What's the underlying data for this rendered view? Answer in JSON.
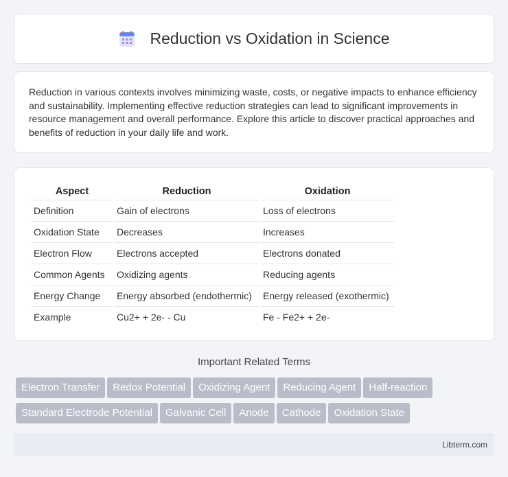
{
  "header": {
    "title": "Reduction vs Oxidation in Science",
    "icon": "calendar-icon"
  },
  "intro": {
    "text": "Reduction in various contexts involves minimizing waste, costs, or negative impacts to enhance efficiency and sustainability. Implementing effective reduction strategies can lead to significant improvements in resource management and overall performance. Explore this article to discover practical approaches and benefits of reduction in your daily life and work."
  },
  "table": {
    "headers": [
      "Aspect",
      "Reduction",
      "Oxidation"
    ],
    "rows": [
      [
        "Definition",
        "Gain of electrons",
        "Loss of electrons"
      ],
      [
        "Oxidation State",
        "Decreases",
        "Increases"
      ],
      [
        "Electron Flow",
        "Electrons accepted",
        "Electrons donated"
      ],
      [
        "Common Agents",
        "Oxidizing agents",
        "Reducing agents"
      ],
      [
        "Energy Change",
        "Energy absorbed (endothermic)",
        "Energy released (exothermic)"
      ],
      [
        "Example",
        "Cu2+ + 2e- - Cu",
        "Fe - Fe2+ + 2e-"
      ]
    ]
  },
  "related": {
    "title": "Important Related Terms",
    "tags": [
      "Electron Transfer",
      "Redox Potential",
      "Oxidizing Agent",
      "Reducing Agent",
      "Half-reaction",
      "Standard Electrode Potential",
      "Galvanic Cell",
      "Anode",
      "Cathode",
      "Oxidation State"
    ]
  },
  "footer": {
    "text": "Libterm.com"
  },
  "colors": {
    "tag_bg": "#b8bdc9",
    "footer_bg": "#e8ecf4",
    "page_bg": "#f3f4f7"
  }
}
